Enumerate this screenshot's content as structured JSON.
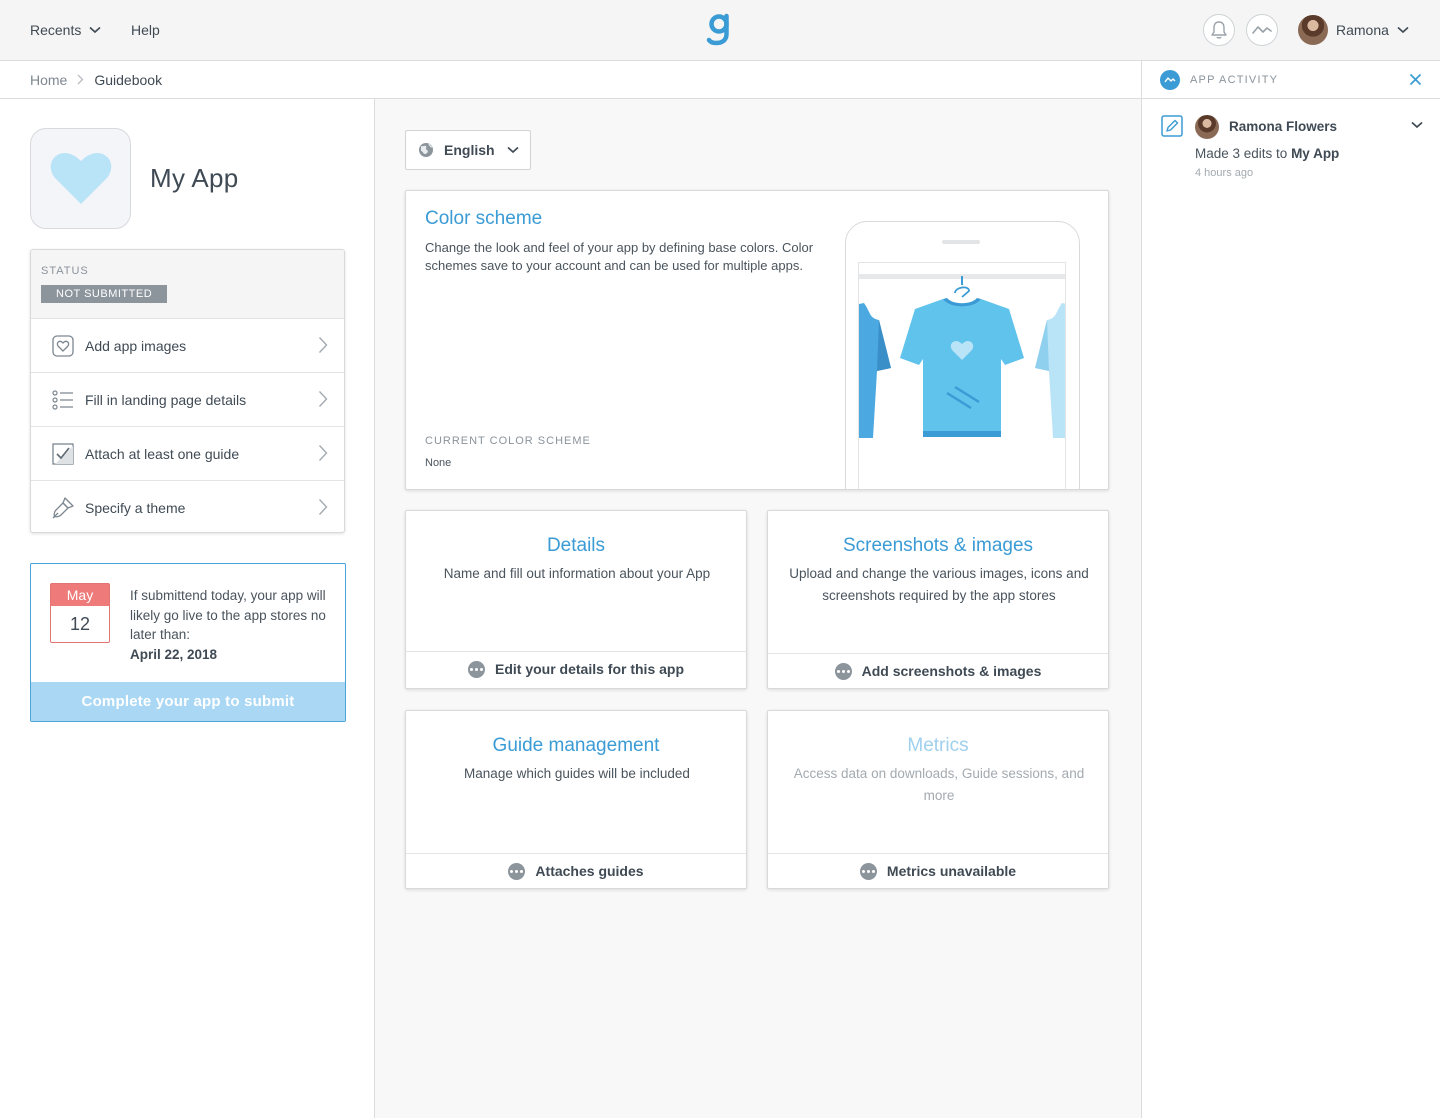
{
  "topbar": {
    "recents_label": "Recents",
    "help_label": "Help",
    "user_name": "Ramona"
  },
  "breadcrumb": {
    "home": "Home",
    "current": "Guidebook"
  },
  "app": {
    "name": "My App"
  },
  "status": {
    "label": "STATUS",
    "badge": "NOT SUBMITTED",
    "tasks": [
      {
        "label": "Add app images",
        "icon": "image-heart-icon"
      },
      {
        "label": "Fill in landing page details",
        "icon": "list-icon"
      },
      {
        "label": "Attach at least one guide",
        "icon": "checkbox-icon"
      },
      {
        "label": "Specify a theme",
        "icon": "brush-icon"
      }
    ]
  },
  "release": {
    "month": "May",
    "day": "12",
    "text": "If submittend today, your app will likely go live to the app stores no later than:",
    "date": "April 22, 2018",
    "button": "Complete your app to submit"
  },
  "language": {
    "selected": "English"
  },
  "color_scheme": {
    "title": "Color scheme",
    "description": "Change the look and feel of your app by defining base colors. Color schemes save to your account and can be used for multiple apps.",
    "current_label": "CURRENT COLOR SCHEME",
    "current_value": "None"
  },
  "tiles": {
    "details": {
      "title": "Details",
      "desc": "Name and fill out information about your App",
      "action": "Edit your details for this app"
    },
    "screenshots": {
      "title": "Screenshots & images",
      "desc": "Upload and change the various images, icons and screenshots required by the app stores",
      "action": "Add screenshots & images"
    },
    "guides": {
      "title": "Guide management",
      "desc": "Manage which guides will be included",
      "action": "Attaches guides"
    },
    "metrics": {
      "title": "Metrics",
      "desc": "Access data on downloads, Guide sessions, and more",
      "action": "Metrics unavailable"
    }
  },
  "activity": {
    "header": "APP ACTIVITY",
    "item": {
      "user": "Ramona Flowers",
      "text_prefix": "Made 3 edits to ",
      "text_target": "My App",
      "time": "4 hours ago"
    }
  },
  "colors": {
    "accent": "#3a9bd5",
    "accent_light": "#a9d7f4",
    "danger": "#ef7a7a",
    "badge": "#8c949c"
  }
}
